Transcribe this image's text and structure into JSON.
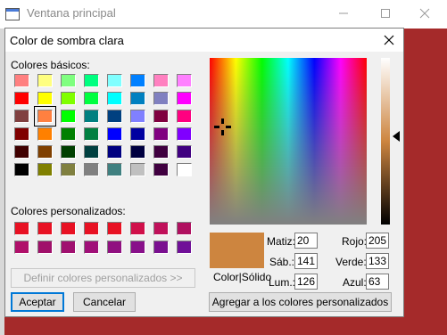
{
  "main_window": {
    "title": "Ventana principal",
    "background_color": "#a52a2a",
    "controls": [
      "minimize-icon",
      "maximize-icon",
      "close-icon"
    ]
  },
  "dialog": {
    "title": "Color de sombra clara",
    "basic_colors_label": "Colores básicos:",
    "custom_colors_label": "Colores personalizados:",
    "basic_colors": [
      "#ff8080",
      "#ffff80",
      "#80ff80",
      "#00ff80",
      "#80ffff",
      "#0080ff",
      "#ff80c0",
      "#ff80ff",
      "#ff0000",
      "#ffff00",
      "#80ff00",
      "#00ff40",
      "#00ffff",
      "#0080c0",
      "#8080c0",
      "#ff00ff",
      "#804040",
      "#ff8040",
      "#00ff00",
      "#008080",
      "#004080",
      "#8080ff",
      "#800040",
      "#ff0080",
      "#800000",
      "#ff8000",
      "#008000",
      "#008040",
      "#0000ff",
      "#0000a0",
      "#800080",
      "#8000ff",
      "#400000",
      "#804000",
      "#004000",
      "#004040",
      "#000080",
      "#000040",
      "#400040",
      "#400080",
      "#000000",
      "#808000",
      "#808040",
      "#808080",
      "#408080",
      "#c0c0c0",
      "#400040",
      "#ffffff"
    ],
    "selected_basic_index": 17,
    "custom_colors": [
      "#e81123",
      "#e81123",
      "#e81123",
      "#e81123",
      "#e81123",
      "#d0104a",
      "#c0105a",
      "#b01060",
      "#b0106a",
      "#a0106a",
      "#a0106f",
      "#a01078",
      "#901080",
      "#88108a",
      "#7a1090",
      "#701098"
    ],
    "define_custom_button": "Definir colores personalizados >>",
    "accept_button": "Aceptar",
    "cancel_button": "Cancelar",
    "color_solid_label": "Color|Sólido",
    "current_color": "#cd853f",
    "fields": {
      "hue_label": "Matiz:",
      "hue": "20",
      "sat_label": "Sáb.:",
      "sat": "141",
      "lum_label": "Lum.:",
      "lum": "126",
      "red_label": "Rojo:",
      "red": "205",
      "green_label": "Verde:",
      "green": "133",
      "blue_label": "Azul:",
      "blue": "63"
    },
    "add_custom_button": "Agregar a los colores personalizados"
  }
}
